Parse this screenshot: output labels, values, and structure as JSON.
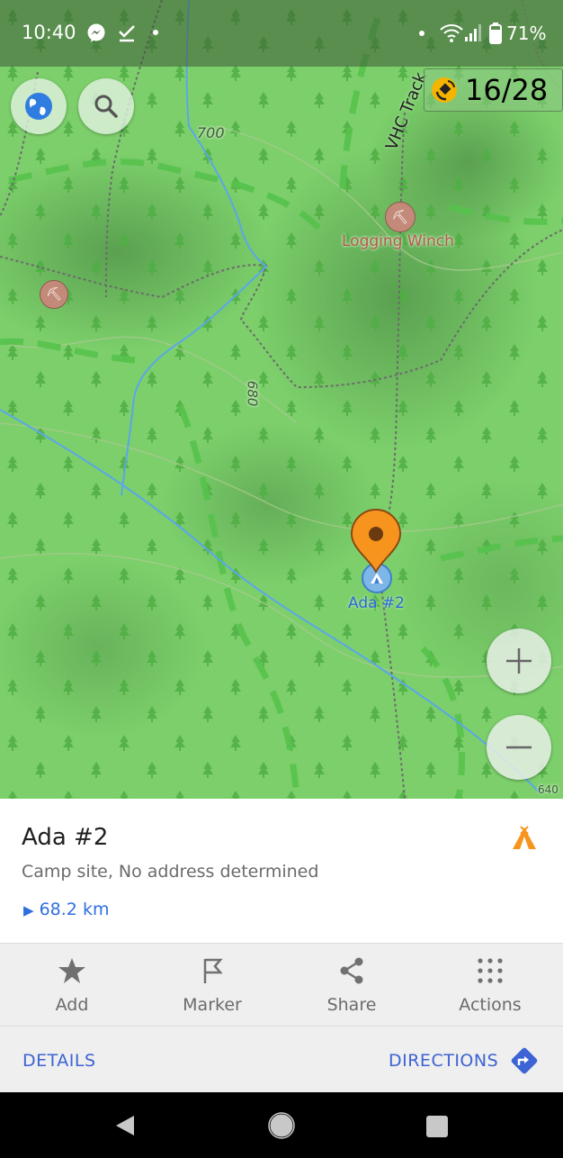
{
  "status_bar": {
    "time": "10:40",
    "battery": "71%"
  },
  "gps": {
    "count": "16/28"
  },
  "map": {
    "labels": {
      "track": "VHC Track",
      "contour_700": "700",
      "contour_680": "680",
      "contour_640": "640",
      "poi": "Logging Winch",
      "marker": "Ada #2"
    }
  },
  "sheet": {
    "title": "Ada #2",
    "subtitle": "Camp site, No address determined",
    "distance": "68.2 km"
  },
  "actions": [
    {
      "label": "Add",
      "icon": "star-icon"
    },
    {
      "label": "Marker",
      "icon": "flag-icon"
    },
    {
      "label": "Share",
      "icon": "share-icon"
    },
    {
      "label": "Actions",
      "icon": "grid-dots-icon"
    }
  ],
  "links": {
    "details": "DETAILS",
    "directions": "DIRECTIONS"
  },
  "colors": {
    "map_green": "#7ccf6b",
    "marker_orange": "#f7941d",
    "link_blue": "#3d63d4",
    "river_blue": "#5aa7e8"
  }
}
